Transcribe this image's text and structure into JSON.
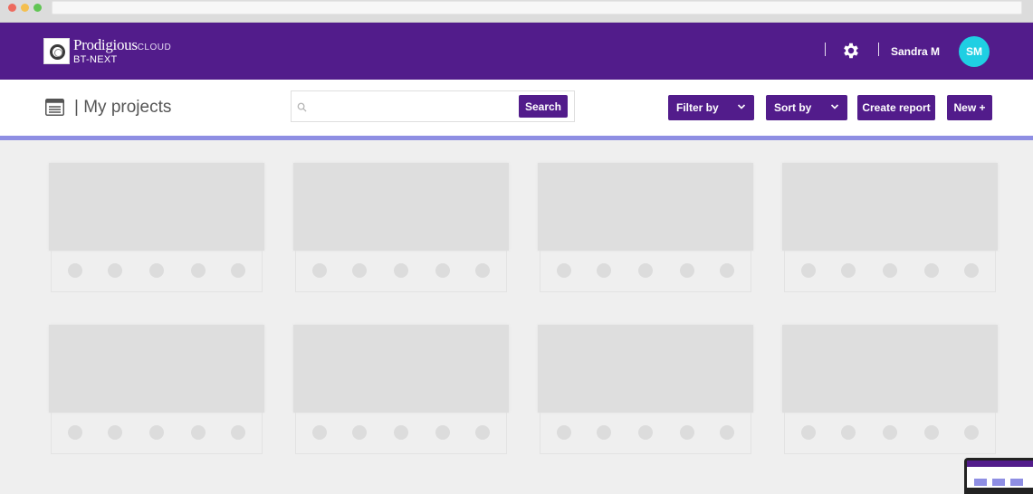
{
  "app": {
    "brand_name": "Prodigious",
    "brand_suffix": "CLOUD",
    "brand_sub": "BT-NEXT"
  },
  "header": {
    "user_name": "Sandra M",
    "avatar_initials": "SM",
    "settings_icon": "gear-icon"
  },
  "toolbar": {
    "page_title": "| My projects",
    "search": {
      "placeholder": "",
      "value": "",
      "button_label": "Search"
    },
    "filter_label": "Filter by",
    "sort_label": "Sort by",
    "create_report_label": "Create report",
    "new_label": "New +"
  },
  "colors": {
    "primary": "#521c8b",
    "accent": "#8e8ee3",
    "avatar": "#1fcfe3",
    "background": "#efefef",
    "placeholder": "#dedede"
  },
  "projects": {
    "rows": 2,
    "columns": 4,
    "cards": [
      {
        "state": "loading-placeholder"
      },
      {
        "state": "loading-placeholder"
      },
      {
        "state": "loading-placeholder"
      },
      {
        "state": "loading-placeholder"
      },
      {
        "state": "loading-placeholder"
      },
      {
        "state": "loading-placeholder"
      },
      {
        "state": "loading-placeholder"
      },
      {
        "state": "loading-placeholder"
      }
    ]
  }
}
